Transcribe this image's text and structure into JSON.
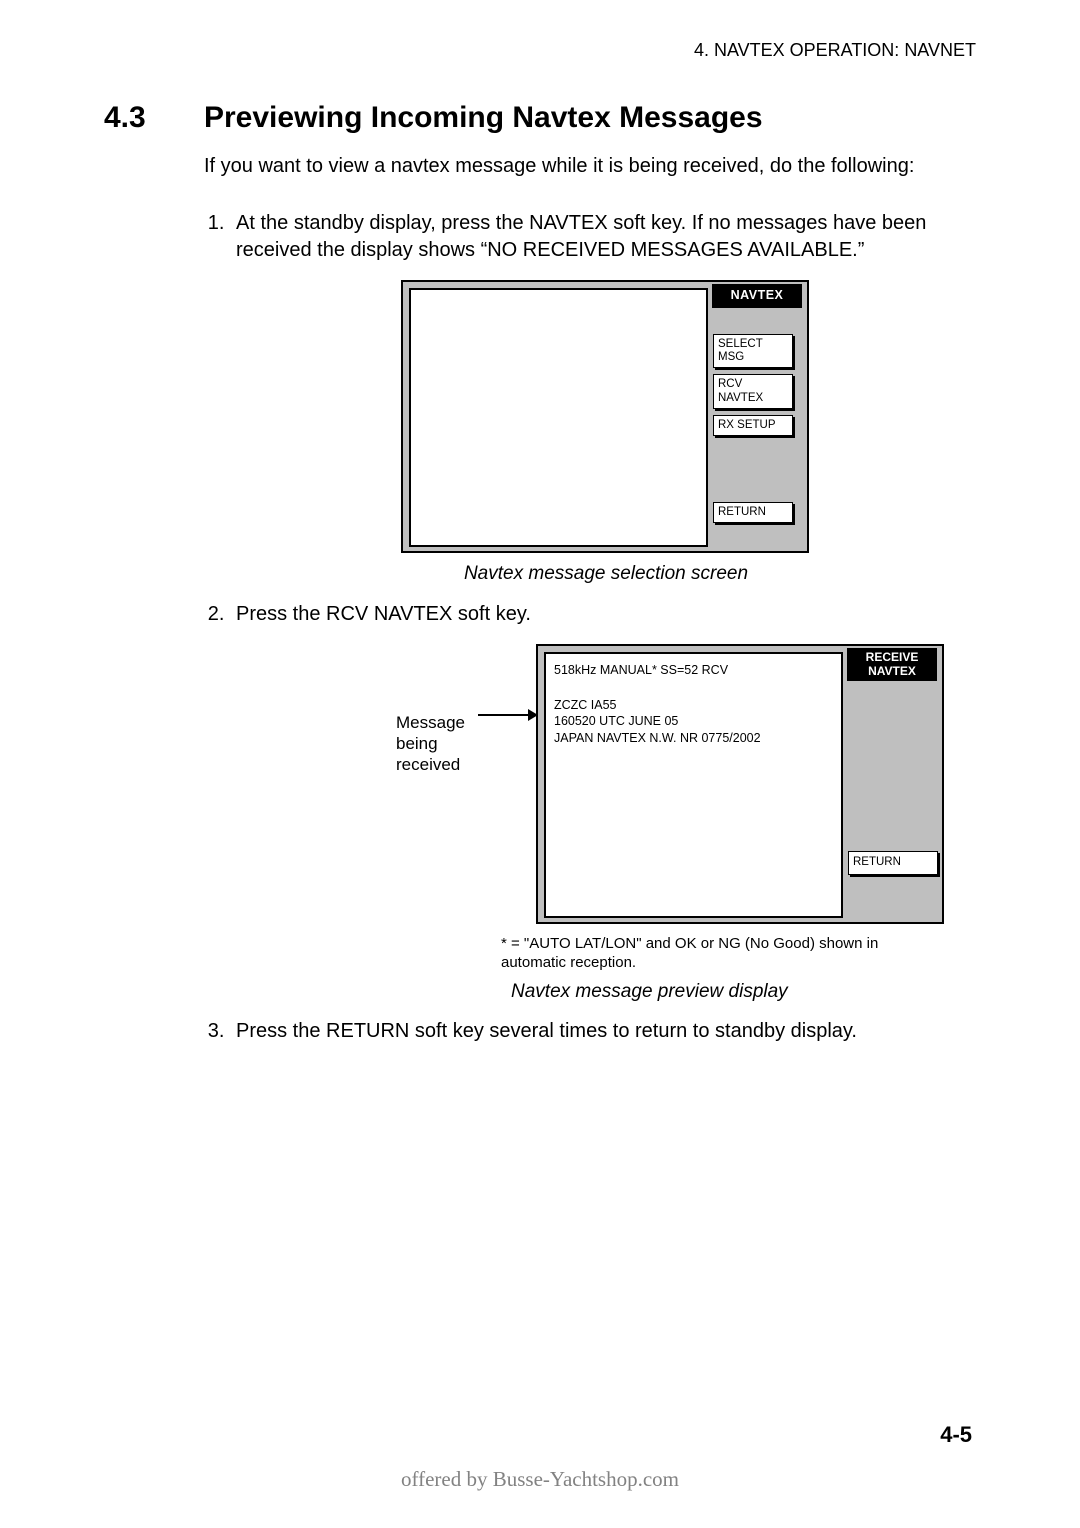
{
  "header": {
    "running": "4. NAVTEX OPERATION: NAVNET"
  },
  "section": {
    "number": "4.3",
    "title": "Previewing Incoming Navtex Messages",
    "intro": "If you want to view a navtex message while it is being received, do the following:"
  },
  "steps": {
    "s1": "At the standby display, press the NAVTEX soft key. If no messages have been received the display shows “NO RECEIVED MESSAGES AVAILABLE.”",
    "s2": "Press the RCV NAVTEX soft key.",
    "s3": "Press the RETURN soft key several times to return to standby display."
  },
  "fig1": {
    "sidebar_title": "NAVTEX",
    "keys": {
      "select_msg": "SELECT MSG",
      "rcv_navtex": "RCV NAVTEX",
      "rx_setup": "RX SETUP",
      "return": "RETURN"
    },
    "caption": "Navtex message selection screen"
  },
  "fig2": {
    "callout": "Message being received",
    "status_line": "518kHz MANUAL* SS=52 RCV",
    "msg_line1": "ZCZC  IA55",
    "msg_line2": "160520 UTC JUNE 05",
    "msg_line3": "JAPAN NAVTEX N.W. NR 0775/2002",
    "sidebar_title": "RECEIVE NAVTEX",
    "return": "RETURN",
    "footnote": "* = \"AUTO LAT/LON\" and OK or NG (No Good) shown in automatic reception.",
    "caption": "Navtex message preview display"
  },
  "page_number": "4-5",
  "offered_by": "offered by Busse-Yachtshop.com"
}
